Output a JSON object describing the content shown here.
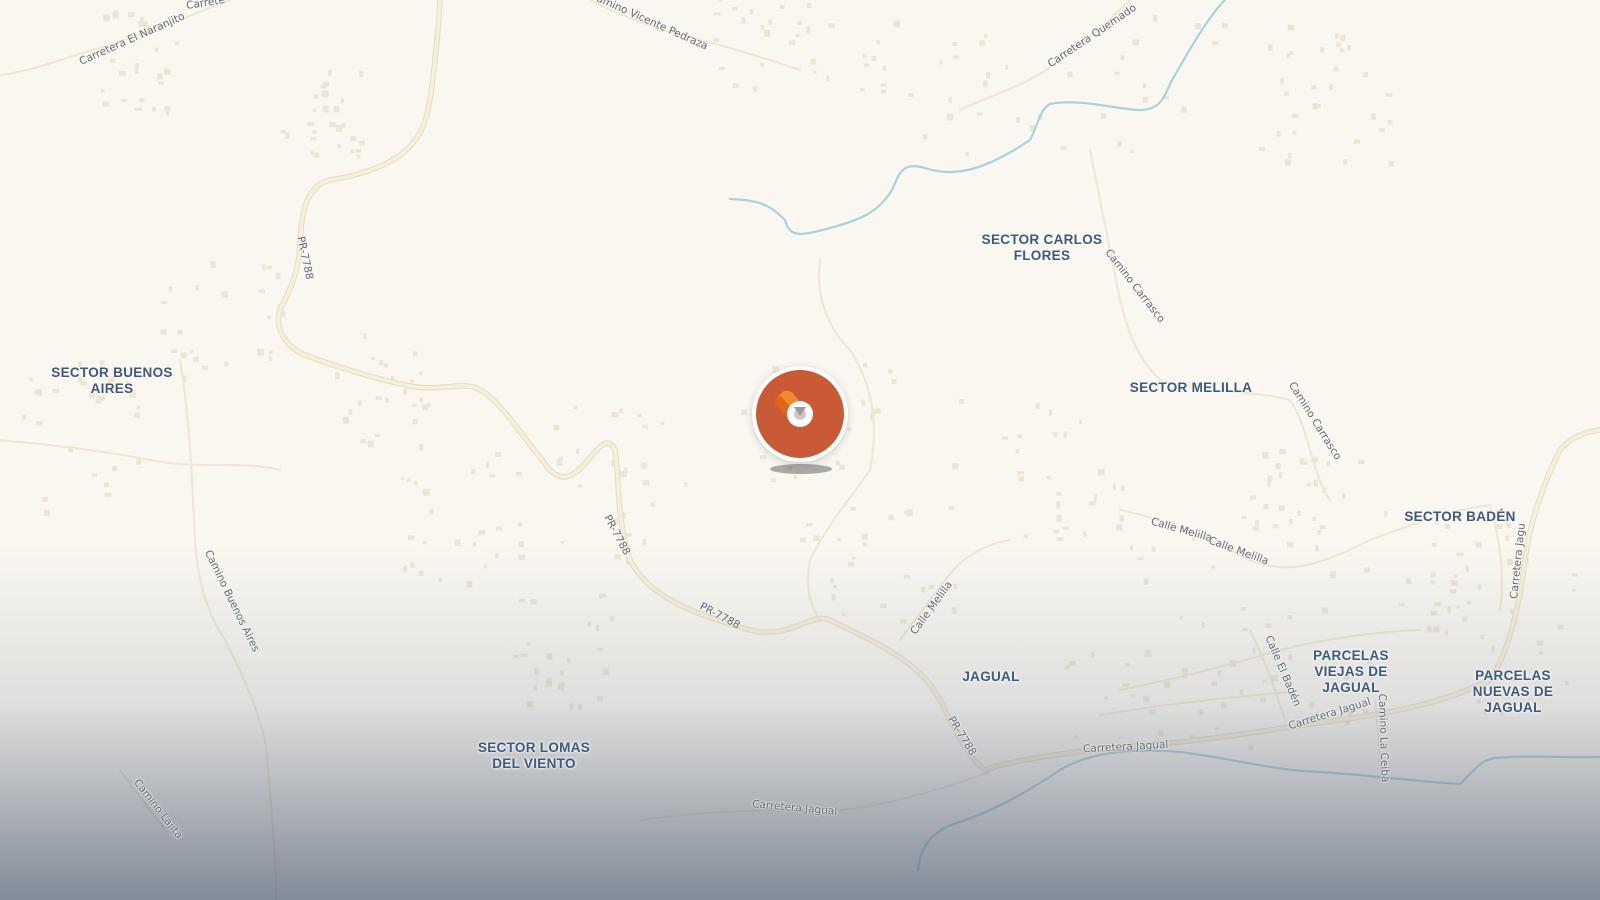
{
  "map": {
    "colors": {
      "land": "#faf7f0",
      "road": "#f3ead2",
      "road_casing": "#e8dcbf",
      "water": "#a9d3dc",
      "building": "#ede5d3",
      "label_place": "#3d5a80",
      "label_road": "#5f6a78",
      "marker": "#c85a35"
    },
    "place_labels": [
      {
        "id": "sector-buenos-aires",
        "text": "SECTOR BUENOS\nAIRES"
      },
      {
        "id": "sector-carlos-flores",
        "text": "SECTOR CARLOS\nFLORES"
      },
      {
        "id": "sector-melilla",
        "text": "SECTOR MELILLA"
      },
      {
        "id": "sector-baden",
        "text": "SECTOR BADÉN"
      },
      {
        "id": "jagual",
        "text": "JAGUAL"
      },
      {
        "id": "parcelas-viejas",
        "text": "PARCELAS\nVIEJAS DE\nJAGUAL"
      },
      {
        "id": "parcelas-nuevas",
        "text": "PARCELAS\nNUEVAS DE\nJAGUAL"
      },
      {
        "id": "sector-lomas",
        "text": "SECTOR LOMAS\nDEL VIENTO"
      }
    ],
    "road_labels": [
      {
        "id": "carretera-el-naranjito",
        "text": "Carretera El Naranjito"
      },
      {
        "id": "carretera-top-left",
        "text": "Carrete"
      },
      {
        "id": "camino-vicente-pedraza",
        "text": "Camino Vicente Pedraza"
      },
      {
        "id": "carretera-quemado",
        "text": "Carretera Quemado"
      },
      {
        "id": "pr7788-north",
        "text": "PR-7788"
      },
      {
        "id": "pr7788-mid",
        "text": "PR-7788"
      },
      {
        "id": "pr7788-center",
        "text": "PR-7788"
      },
      {
        "id": "pr7788-south",
        "text": "PR-7788"
      },
      {
        "id": "camino-carrasco-1",
        "text": "Camino Carrasco"
      },
      {
        "id": "camino-carrasco-2",
        "text": "Camino Carrasco"
      },
      {
        "id": "calle-melilla-1",
        "text": "Calle Melilla"
      },
      {
        "id": "calle-melilla-2",
        "text": "Calle Melilla"
      },
      {
        "id": "calle-melilla-3",
        "text": "Calle Melilla"
      },
      {
        "id": "camino-buenos-aires",
        "text": "Camino Buenos Aires"
      },
      {
        "id": "camino-lajita",
        "text": "Camino Lajita"
      },
      {
        "id": "carretera-jagual-1",
        "text": "Carretera Jagual"
      },
      {
        "id": "carretera-jagual-2",
        "text": "Carretera Jagual"
      },
      {
        "id": "carretera-jagual-3",
        "text": "Carretera Jagual"
      },
      {
        "id": "calle-el-baden",
        "text": "Calle El Badén"
      },
      {
        "id": "camino-la-ceiba",
        "text": "Camino La Ceiba"
      },
      {
        "id": "carretera-jagual-east",
        "text": "Carretera Jagu"
      }
    ],
    "marker": {
      "icon": "location-pin-icon"
    }
  }
}
